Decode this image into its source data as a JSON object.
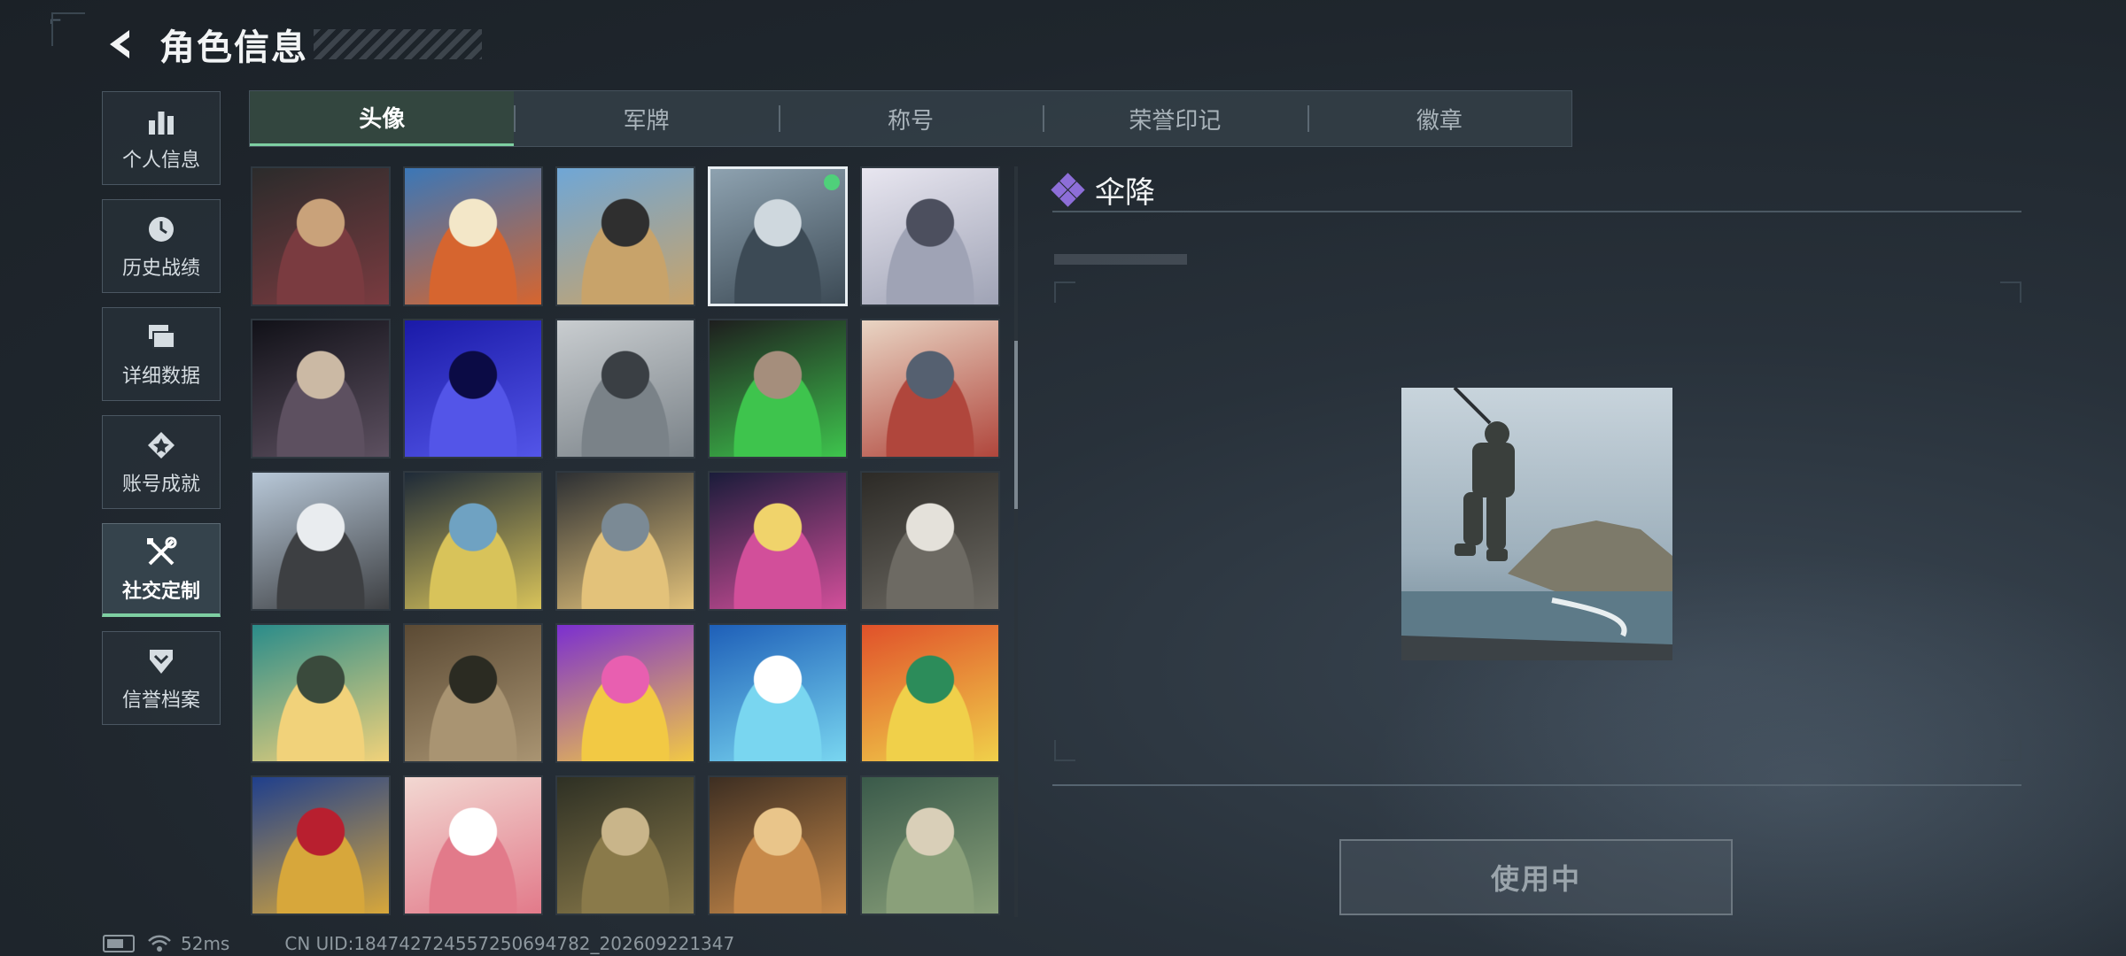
{
  "header": {
    "title": "角色信息",
    "back_icon": "back-arrow-icon"
  },
  "nav": {
    "items": [
      {
        "label": "个人信息",
        "icon": "bar-chart-icon",
        "active": false
      },
      {
        "label": "历史战绩",
        "icon": "clock-history-icon",
        "active": false
      },
      {
        "label": "详细数据",
        "icon": "stacked-cards-icon",
        "active": false
      },
      {
        "label": "账号成就",
        "icon": "achievement-star-icon",
        "active": false
      },
      {
        "label": "社交定制",
        "icon": "tools-icon",
        "active": true
      },
      {
        "label": "信誉档案",
        "icon": "shield-chevron-icon",
        "active": false
      }
    ]
  },
  "tabs": [
    {
      "label": "头像",
      "active": true
    },
    {
      "label": "军牌",
      "active": false
    },
    {
      "label": "称号",
      "active": false
    },
    {
      "label": "荣誉印记",
      "active": false
    },
    {
      "label": "徽章",
      "active": false
    }
  ],
  "avatars": [
    {
      "colors": [
        "#2b2b2b",
        "#7a3b40",
        "#c9a27a"
      ]
    },
    {
      "colors": [
        "#3b77b7",
        "#d6652f",
        "#f3e7c8"
      ]
    },
    {
      "colors": [
        "#6fa6d6",
        "#c8a36a",
        "#2f2f2f"
      ]
    },
    {
      "colors": [
        "#8ea2b0",
        "#3c4a55",
        "#cfd8de"
      ],
      "selected": true,
      "equipped": true
    },
    {
      "colors": [
        "#e8e6f0",
        "#9fa3b5",
        "#4c4f5e"
      ]
    },
    {
      "colors": [
        "#111118",
        "#5d5060",
        "#cbb9a4"
      ]
    },
    {
      "colors": [
        "#1a1aa8",
        "#5355e8",
        "#0b0b45"
      ]
    },
    {
      "colors": [
        "#c9cdd0",
        "#7a8288",
        "#3a3f44"
      ]
    },
    {
      "colors": [
        "#1e1e1e",
        "#3ec44d",
        "#a58e7c"
      ]
    },
    {
      "colors": [
        "#e9d5c4",
        "#b0463c",
        "#556070"
      ]
    },
    {
      "colors": [
        "#b8c8d8",
        "#3d3f42",
        "#e9ecef"
      ]
    },
    {
      "colors": [
        "#1e2a38",
        "#d8c35a",
        "#6fa2c2"
      ]
    },
    {
      "colors": [
        "#2c2f33",
        "#e3c27a",
        "#7b8a95"
      ]
    },
    {
      "colors": [
        "#1a1c3a",
        "#d24f9a",
        "#f0d36b"
      ]
    },
    {
      "colors": [
        "#2c2a26",
        "#6d6a63",
        "#e4e1da"
      ]
    },
    {
      "colors": [
        "#2a8c8a",
        "#f1d27a",
        "#3a4a3c"
      ]
    },
    {
      "colors": [
        "#5b4a34",
        "#a99472",
        "#2b2b22"
      ]
    },
    {
      "colors": [
        "#7b2fd0",
        "#f2c944",
        "#e85fb0"
      ]
    },
    {
      "colors": [
        "#1e5fb8",
        "#79d6f0",
        "#ffffff"
      ]
    },
    {
      "colors": [
        "#e0512a",
        "#f0d04a",
        "#2c8c5a"
      ]
    },
    {
      "colors": [
        "#1f3f8c",
        "#d7a73b",
        "#b81f2f"
      ]
    },
    {
      "colors": [
        "#f2d8d2",
        "#e27a8a",
        "#ffffff"
      ]
    },
    {
      "colors": [
        "#2e3024",
        "#8a7a4a",
        "#c9b58a"
      ]
    },
    {
      "colors": [
        "#3d2e22",
        "#c88a4a",
        "#e9c58a"
      ]
    },
    {
      "colors": [
        "#3a5a4a",
        "#8aa07a",
        "#d9cfb8"
      ]
    }
  ],
  "detail": {
    "name": "伞降",
    "title_icon": "purple-diamond-icon",
    "use_button_label": "使用中"
  },
  "status_bar": {
    "battery_icon": "battery-icon",
    "wifi_icon": "wifi-icon",
    "ping": "52ms",
    "uid": "CN UID:18474272455725069478​2_202609221347"
  }
}
